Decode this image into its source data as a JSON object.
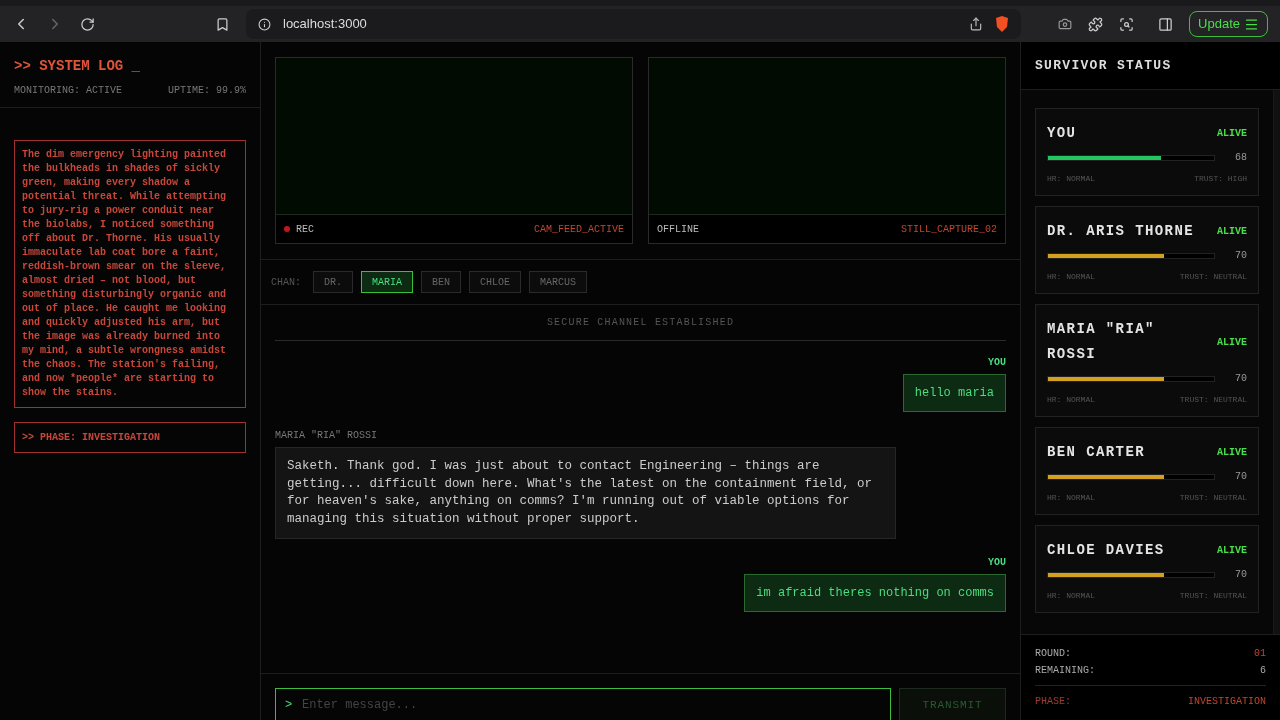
{
  "browser": {
    "url": "localhost:3000",
    "update_label": "Update"
  },
  "system_log": {
    "title": ">> SYSTEM LOG _",
    "monitoring": "MONITORING: ACTIVE",
    "uptime": "UPTIME: 99.9%",
    "log_text": "The dim emergency lighting painted the bulkheads in shades of sickly green, making every shadow a potential threat. While attempting to jury-rig a power conduit near the biolabs, I noticed something off about Dr. Thorne. His usually immaculate lab coat bore a faint, reddish-brown smear on the sleeve, almost dried – not blood, but something disturbingly organic and out of place. He caught me looking and quickly adjusted his arm, but the image was already burned into my mind, a subtle wrongness amidst the chaos. The station's failing, and now *people* are starting to show the stains.",
    "phase": ">> PHASE: INVESTIGATION"
  },
  "cameras": [
    {
      "kind": "rec",
      "status": "REC",
      "feed": "CAM_FEED_ACTIVE"
    },
    {
      "kind": "offline",
      "status": "OFFLINE",
      "feed": "STILL_CAPTURE_02"
    }
  ],
  "channels": {
    "label": "CHAN:",
    "tabs": [
      {
        "label": "DR.",
        "selected": false
      },
      {
        "label": "MARIA",
        "selected": true
      },
      {
        "label": "BEN",
        "selected": false
      },
      {
        "label": "CHLOE",
        "selected": false
      },
      {
        "label": "MARCUS",
        "selected": false
      }
    ]
  },
  "chat": {
    "banner": "SECURE CHANNEL ESTABLISHED",
    "messages": [
      {
        "kind": "you",
        "sender": "YOU",
        "text": "hello maria"
      },
      {
        "kind": "npc",
        "sender": "MARIA \"RIA\" ROSSI",
        "text": "Saketh. Thank god. I was just about to contact Engineering – things are getting... difficult down here. What's the latest on the containment field, or for heaven's sake, anything on comms? I'm running out of viable options for managing this situation without proper support."
      },
      {
        "kind": "you",
        "sender": "YOU",
        "text": "im afraid theres nothing on comms"
      }
    ]
  },
  "input": {
    "prompt": ">",
    "placeholder": "Enter message...",
    "button": "TRANSMIT"
  },
  "survivors": {
    "title": "SURVIVOR STATUS",
    "cards": [
      {
        "name": "YOU",
        "status": "ALIVE",
        "level": 0.68,
        "value": "68",
        "color": "#22c55e",
        "hr": "HR: NORMAL",
        "trust": "TRUST: HIGH"
      },
      {
        "name": "DR. ARIS THORNE",
        "status": "ALIVE",
        "level": 0.7,
        "value": "70",
        "color": "#d4a020",
        "hr": "HR: NORMAL",
        "trust": "TRUST: NEUTRAL"
      },
      {
        "name": "MARIA \"RIA\" ROSSI",
        "status": "ALIVE",
        "level": 0.7,
        "value": "70",
        "color": "#d4a020",
        "hr": "HR: NORMAL",
        "trust": "TRUST: NEUTRAL"
      },
      {
        "name": "BEN CARTER",
        "status": "ALIVE",
        "level": 0.7,
        "value": "70",
        "color": "#d4a020",
        "hr": "HR: NORMAL",
        "trust": "TRUST: NEUTRAL"
      },
      {
        "name": "CHLOE DAVIES",
        "status": "ALIVE",
        "level": 0.7,
        "value": "70",
        "color": "#d4a020",
        "hr": "HR: NORMAL",
        "trust": "TRUST: NEUTRAL"
      }
    ]
  },
  "footer": {
    "round_label": "ROUND:",
    "round": "01",
    "remaining_label": "REMAINING:",
    "remaining": "6",
    "phase_label": "PHASE:",
    "phase": "INVESTIGATION"
  }
}
